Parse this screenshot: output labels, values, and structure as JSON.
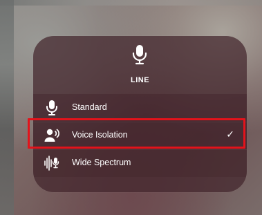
{
  "panel": {
    "app_name": "LINE",
    "header_icon": "microphone-icon",
    "options": [
      {
        "label": "Standard",
        "icon": "microphone-icon",
        "selected": false
      },
      {
        "label": "Voice Isolation",
        "icon": "person-voice-icon",
        "selected": true
      },
      {
        "label": "Wide Spectrum",
        "icon": "waveform-mic-icon",
        "selected": false
      }
    ],
    "check_mark": "✓"
  },
  "highlight": {
    "color": "#e3131b",
    "target": "Voice Isolation"
  }
}
